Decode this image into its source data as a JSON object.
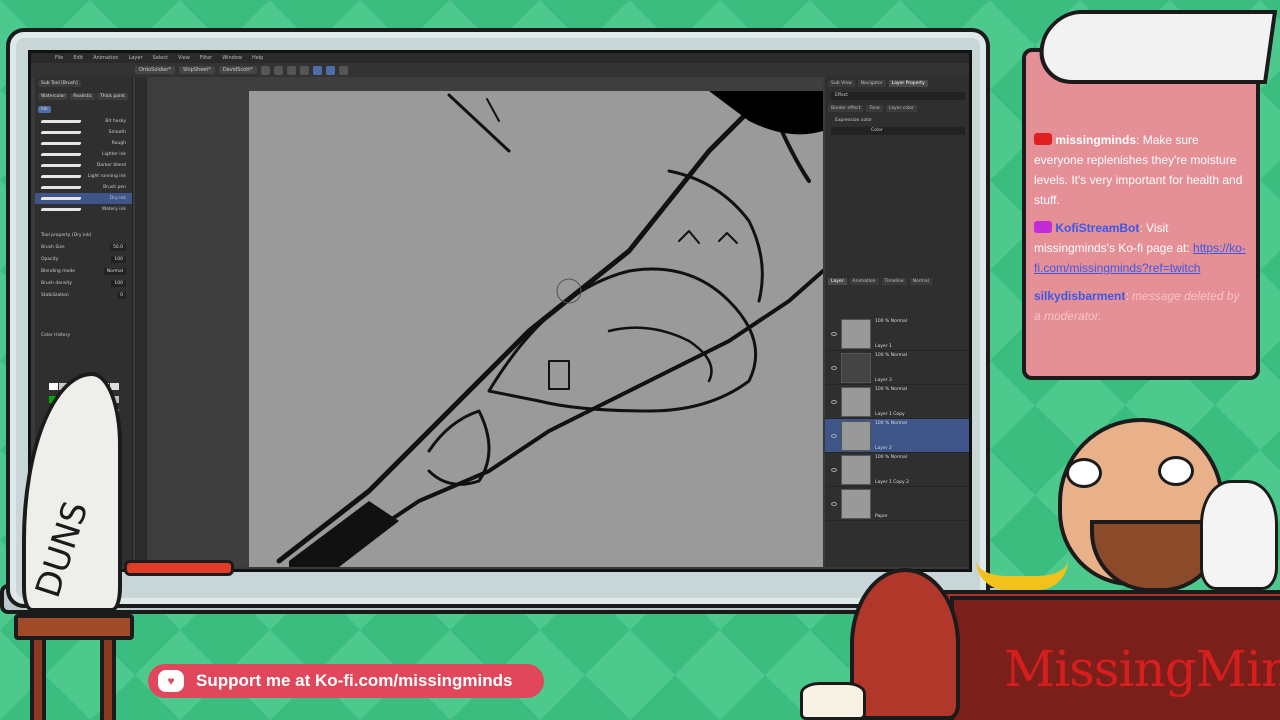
{
  "app": {
    "menu": [
      "File",
      "Edit",
      "Animation",
      "Layer",
      "Select",
      "View",
      "Filter",
      "Window",
      "Help"
    ],
    "doc_tabs": [
      "OrdoSoldier*",
      "ShipSheet*",
      "DavidScott*"
    ],
    "subtool": {
      "tabs": [
        "Sub Tool [Brush]",
        "Watercolor",
        "Realistic",
        "Thick paint",
        "Ink"
      ],
      "brushes": [
        "Bit husky",
        "Smooth",
        "Rough",
        "Lighter ink",
        "Darker blend",
        "Light running ink",
        "Brush pen",
        "Dry ink",
        "Watery ink"
      ],
      "selected_brush": "Dry ink"
    },
    "tool_property": {
      "title": "Tool property (Dry ink)",
      "rows": [
        {
          "label": "Brush Size",
          "value": "50.0"
        },
        {
          "label": "Opacity",
          "value": "100"
        },
        {
          "label": "Blending mode",
          "value": "Normal"
        },
        {
          "label": "Brush density",
          "value": "100"
        },
        {
          "label": "Stabilization",
          "value": "0"
        }
      ]
    },
    "color_history_label": "Color History",
    "color_swatches": [
      "#ffffff",
      "#c8c8c8",
      "#ffcc00",
      "#ff9900",
      "#ff6600",
      "#ffffff",
      "#dddddd",
      "#00aa00",
      "#33cc33",
      "#ffcc99",
      "#ff9966",
      "#ffffff",
      "#f0f0f0",
      "#bbbbbb",
      "#000000",
      "#333333",
      "#ffaa00",
      "#cc6600",
      "#996633",
      "#ffffff",
      "#aaaaaa",
      "#cccccc",
      "#999999",
      "#ff3300",
      "#ff0000",
      "#cc0000",
      "#00cc00",
      "#ffffff"
    ],
    "right_panel": {
      "tabs": [
        "Sub View",
        "Navigator",
        "Layer Property"
      ],
      "effect_label": "Effect",
      "effects": [
        "Border effect",
        "Tone",
        "Layer color"
      ],
      "expression_color_label": "Expression color",
      "expression_color_value": "Color",
      "layer_tabs": [
        "Layer",
        "Animation",
        "Timeline"
      ],
      "layer_blend": "Normal",
      "layers": [
        {
          "blend": "100 % Normal",
          "name": "Layer 1"
        },
        {
          "blend": "100 % Normal",
          "name": "Layer 3"
        },
        {
          "blend": "100 % Normal",
          "name": "Layer 1 Copy"
        },
        {
          "blend": "100 % Normal",
          "name": "Layer 2"
        },
        {
          "blend": "100 % Normal",
          "name": "Layer 1 Copy 2"
        },
        {
          "blend": "",
          "name": "Paper"
        }
      ],
      "selected_layer": "Layer 2"
    }
  },
  "chat": {
    "messages": [
      {
        "user": "missingminds",
        "user_color": "#ffffff",
        "badge_color": "#e02020",
        "text": "Make sure everyone replenishes they're moisture levels. It's very important for health and stuff.",
        "style": "normal"
      },
      {
        "user": "KofiStreamBot",
        "user_color": "#3a5ae6",
        "badge_color": "#c12cd8",
        "text": "Visit missingminds's Ko-fi page at:",
        "style": "normal"
      },
      {
        "user": "",
        "user_color": "",
        "badge_color": "",
        "text": "https://ko-fi.com/missingminds?ref=twitch",
        "style": "link"
      },
      {
        "user": "silkydisbarment",
        "user_color": "#3a5ae6",
        "badge_color": "",
        "text": "message deleted by a moderator.",
        "style": "deleted"
      }
    ]
  },
  "overlay": {
    "tooth_label": "DUNS",
    "brand": "MissingMinds",
    "kofi_banner": "Support me at Ko-fi.com/missingminds"
  }
}
